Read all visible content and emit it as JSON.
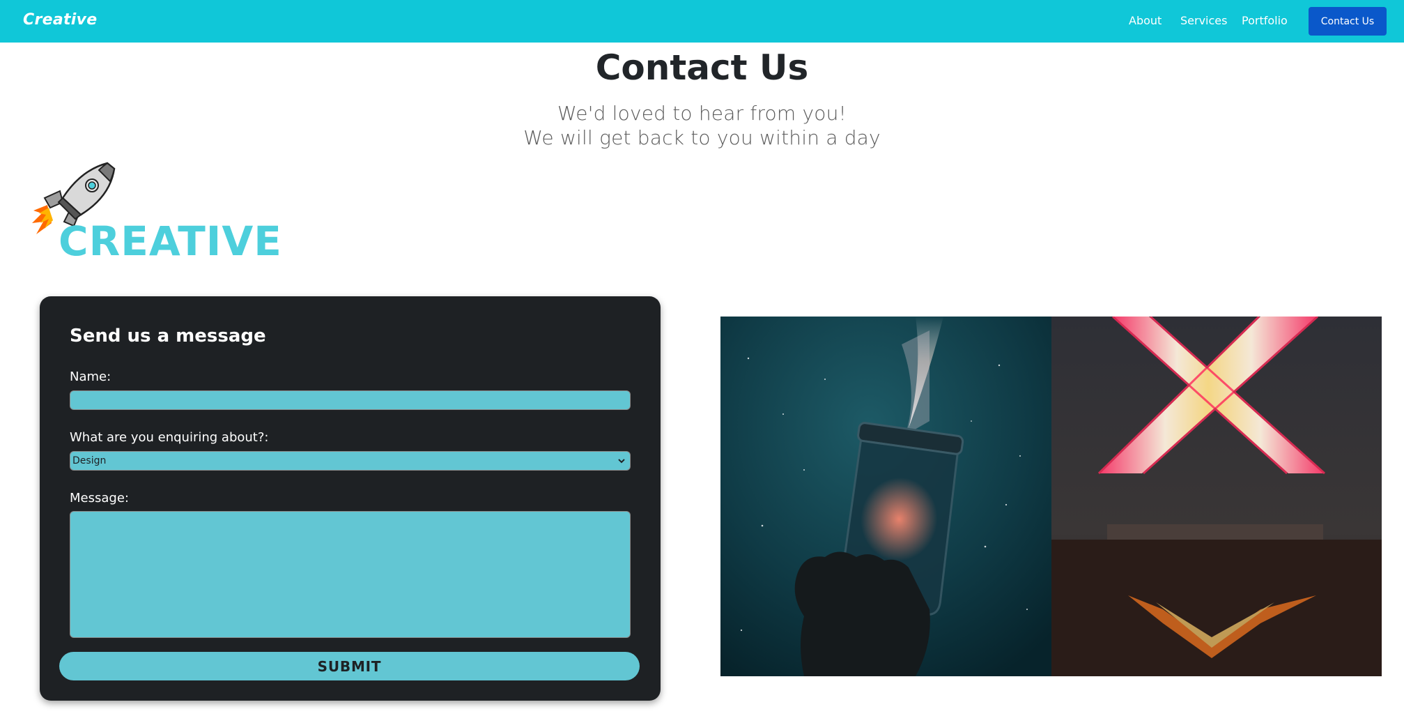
{
  "navbar": {
    "brand": "Creative",
    "links": [
      {
        "label": "About"
      },
      {
        "label": "Services"
      },
      {
        "label": "Portfolio"
      }
    ],
    "cta_label": "Contact Us",
    "background_color": "#10c7d8",
    "cta_color": "#0a58ca"
  },
  "header": {
    "title": "Contact Us",
    "subtitle_line1": "We'd loved to hear from you!",
    "subtitle_line2": "We will get back to you within a day"
  },
  "logo": {
    "text": "CREATIVE",
    "icon": "rocket-icon",
    "color": "#4dcfdc"
  },
  "form": {
    "heading": "Send us a message",
    "name_label": "Name:",
    "name_value": "",
    "enquiry_label": "What are you enquiring about?:",
    "enquiry_selected": "Design",
    "message_label": "Message:",
    "message_value": "",
    "submit_label": "SUBMIT",
    "card_color": "#1e2124",
    "field_color": "#62c6d3"
  },
  "gallery": {
    "images": [
      {
        "subject": "galaxy-jar-photo"
      },
      {
        "subject": "neon-x-photo"
      }
    ]
  }
}
